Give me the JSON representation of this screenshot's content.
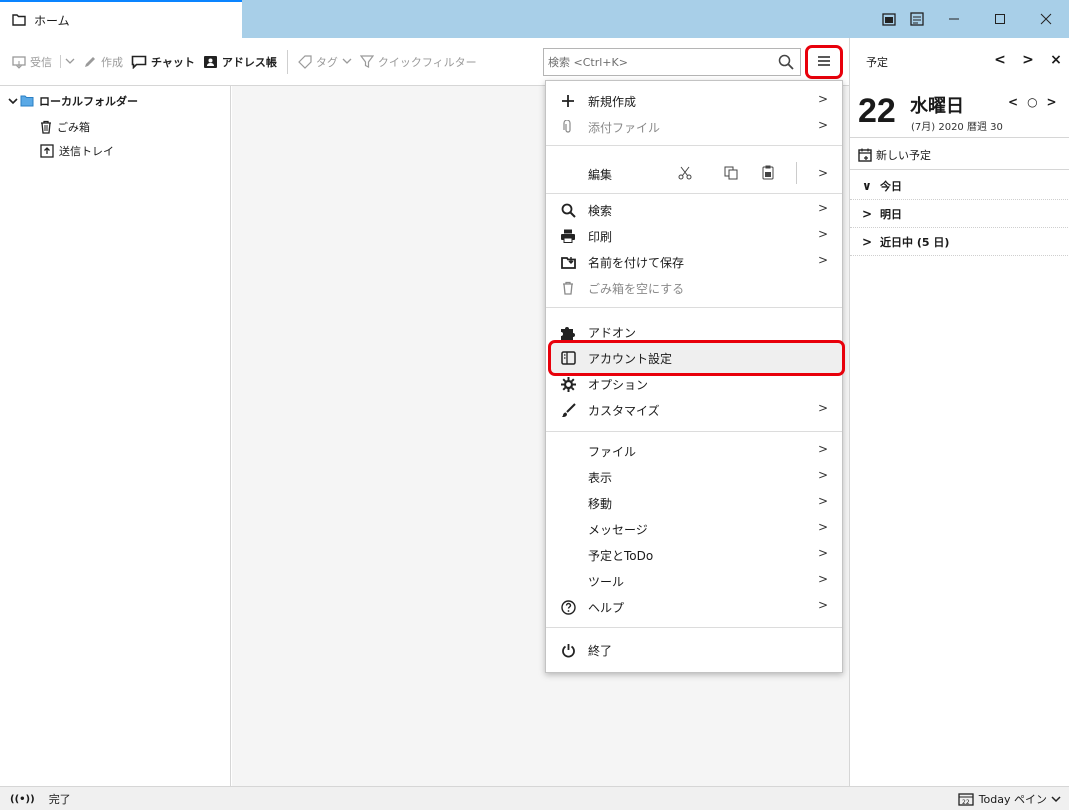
{
  "tab": {
    "label": "ホーム"
  },
  "toolbar": {
    "get_mail": "受信",
    "write": "作成",
    "chat": "チャット",
    "address_book": "アドレス帳",
    "tag": "タグ",
    "quick_filter": "クイックフィルター"
  },
  "search": {
    "placeholder": "検索 <Ctrl+K>"
  },
  "folders": {
    "root": "ローカルフォルダー",
    "trash": "ごみ箱",
    "outbox": "送信トレイ"
  },
  "app_menu": {
    "new": "新規作成",
    "attach": "添付ファイル",
    "edit": "編集",
    "find": "検索",
    "print": "印刷",
    "save_as": "名前を付けて保存",
    "empty_trash": "ごみ箱を空にする",
    "addons": "アドオン",
    "account_settings": "アカウント設定",
    "options": "オプション",
    "customize": "カスタマイズ",
    "file": "ファイル",
    "view": "表示",
    "go": "移動",
    "message": "メッセージ",
    "events_tasks": "予定とToDo",
    "tools": "ツール",
    "help": "ヘルプ",
    "quit": "終了"
  },
  "calendar": {
    "header": "予定",
    "day": "22",
    "weekday": "水曜日",
    "subline": "(7月) 2020 暦週 30",
    "new_event": "新しい予定",
    "today": "今日",
    "tomorrow": "明日",
    "upcoming": "近日中 (5 日)"
  },
  "status": {
    "text": "完了",
    "today_pane": "Today ペイン"
  },
  "colors": {
    "accent": "#0a84ff",
    "highlight_red": "#e8000b",
    "titlebar": "#a8cfe8"
  }
}
